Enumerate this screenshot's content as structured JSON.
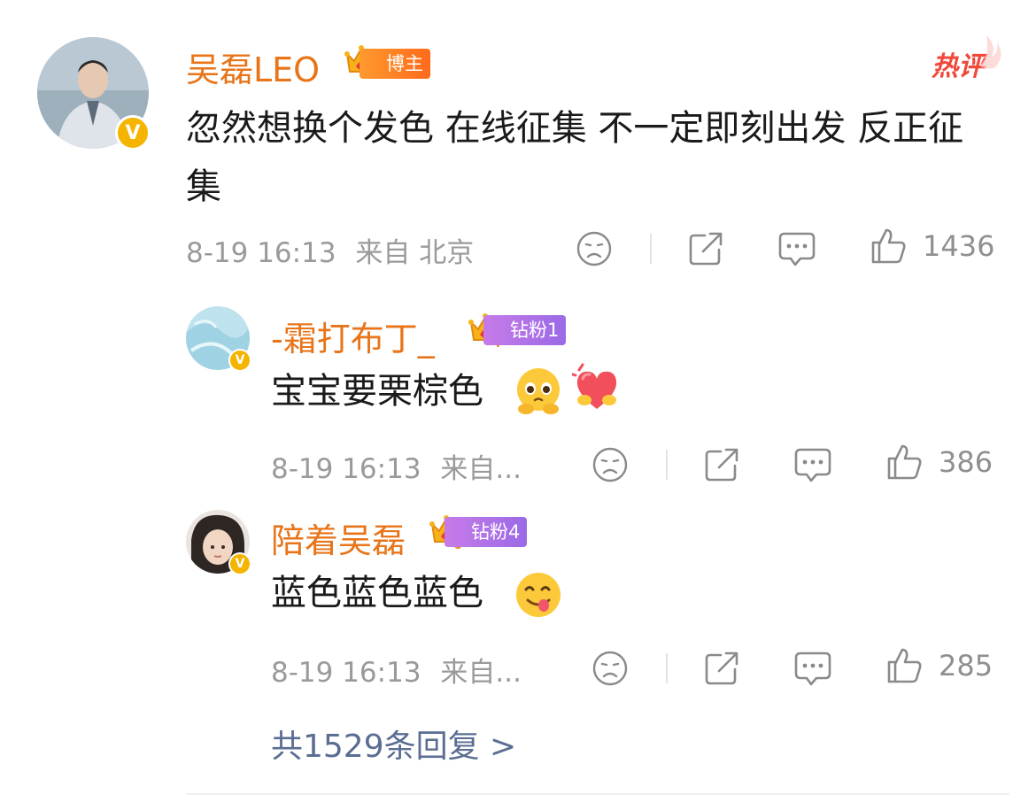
{
  "hot_label": "热评",
  "main_comment": {
    "name": "吴磊LEO",
    "tag": "博主",
    "crown_level": "7",
    "text": "忽然想换个发色 在线征集 不一定即刻出发 反正征集",
    "time": "8-19 16:13",
    "source": "来自 北京",
    "likes": "1436"
  },
  "replies": [
    {
      "name": "-霜打布丁_",
      "tag": "钻粉1",
      "crown_level": "4",
      "text": "宝宝要栗棕色",
      "emojis": [
        "pleading-face-emoji",
        "heart-emoji"
      ],
      "time": "8-19 16:13",
      "source": "来自...",
      "likes": "386"
    },
    {
      "name": "陪着吴磊",
      "tag": "钻粉4",
      "crown_level": "6",
      "text": "蓝色蓝色蓝色",
      "emojis": [
        "yum-face-emoji"
      ],
      "time": "8-19 16:13",
      "source": "来自...",
      "likes": "285"
    }
  ],
  "more_replies": "共1529条回复 >",
  "colors": {
    "name": "#e8751a",
    "link": "#5a6d92",
    "meta": "#9a9a9a",
    "hot": "#f0483a"
  }
}
